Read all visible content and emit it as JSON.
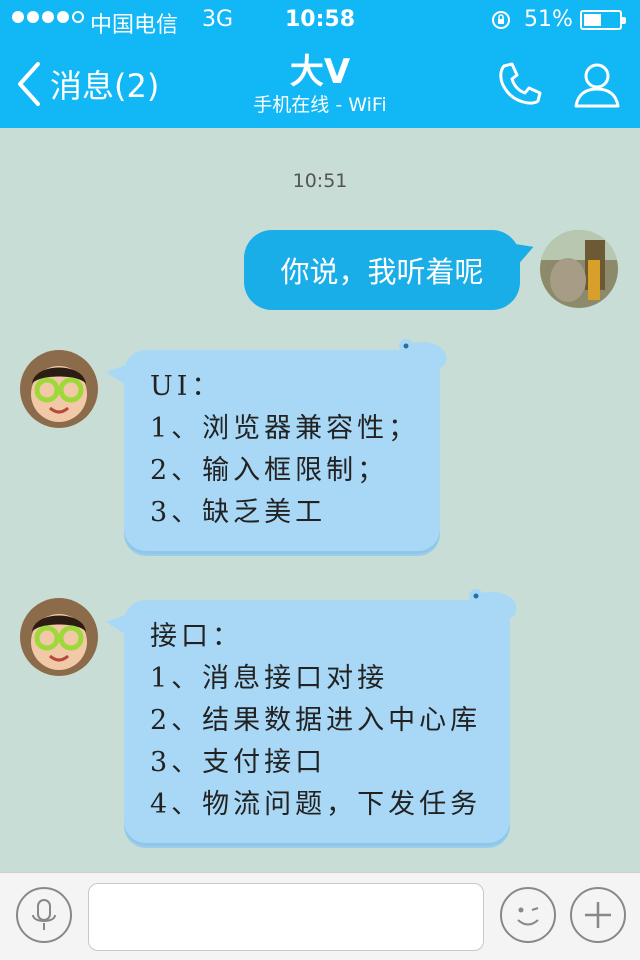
{
  "status_bar": {
    "carrier": "中国电信",
    "network": "3G",
    "time": "10:58",
    "battery_percent": "51%",
    "battery_level": 0.51,
    "signal_bars_filled": 4,
    "signal_bars_total": 5
  },
  "nav": {
    "back_label": "消息(2)",
    "title": "大V",
    "subtitle": "手机在线 - WiFi"
  },
  "chat": {
    "timestamp": "10:51",
    "outgoing": {
      "text": "你说，我听着呢"
    },
    "incoming": [
      {
        "lines": [
          "UI：",
          "1、浏览器兼容性；",
          "2、输入框限制；",
          "3、缺乏美工"
        ]
      },
      {
        "lines": [
          "接口：",
          "1、消息接口对接",
          "2、结果数据进入中心库",
          "3、支付接口",
          "4、物流问题，下发任务"
        ]
      }
    ]
  },
  "input_bar": {
    "text_value": "",
    "icons": [
      "microphone-icon",
      "emoji-icon",
      "plus-icon"
    ]
  },
  "colors": {
    "header": "#12b7f5",
    "background": "#c8ddd6",
    "outgoing_bubble": "#1aaee8",
    "incoming_bubble": "#a9d8f6"
  }
}
